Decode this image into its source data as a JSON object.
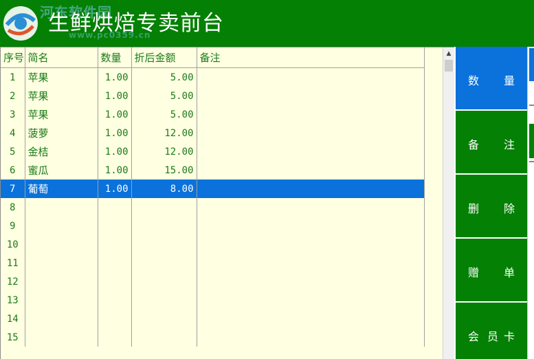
{
  "header": {
    "title": "生鲜烘焙专卖前台",
    "watermark": "河东软件园",
    "watermark_url": "www.pc0359.cn",
    "background": "#048004"
  },
  "grid": {
    "columns": [
      "序号",
      "简名",
      "数量",
      "折后金额",
      "备注"
    ],
    "rows": [
      {
        "no": "1",
        "name": "苹果",
        "qty": "1.00",
        "amount": "5.00",
        "note": ""
      },
      {
        "no": "2",
        "name": "苹果",
        "qty": "1.00",
        "amount": "5.00",
        "note": ""
      },
      {
        "no": "3",
        "name": "苹果",
        "qty": "1.00",
        "amount": "5.00",
        "note": ""
      },
      {
        "no": "4",
        "name": "菠萝",
        "qty": "1.00",
        "amount": "12.00",
        "note": ""
      },
      {
        "no": "5",
        "name": "金桔",
        "qty": "1.00",
        "amount": "12.00",
        "note": ""
      },
      {
        "no": "6",
        "name": "蜜瓜",
        "qty": "1.00",
        "amount": "15.00",
        "note": ""
      },
      {
        "no": "7",
        "name": "葡萄",
        "qty": "1.00",
        "amount": "8.00",
        "note": ""
      },
      {
        "no": "8",
        "name": "",
        "qty": "",
        "amount": "",
        "note": ""
      },
      {
        "no": "9",
        "name": "",
        "qty": "",
        "amount": "",
        "note": ""
      },
      {
        "no": "10",
        "name": "",
        "qty": "",
        "amount": "",
        "note": ""
      },
      {
        "no": "11",
        "name": "",
        "qty": "",
        "amount": "",
        "note": ""
      },
      {
        "no": "12",
        "name": "",
        "qty": "",
        "amount": "",
        "note": ""
      },
      {
        "no": "13",
        "name": "",
        "qty": "",
        "amount": "",
        "note": ""
      },
      {
        "no": "14",
        "name": "",
        "qty": "",
        "amount": "",
        "note": ""
      },
      {
        "no": "15",
        "name": "",
        "qty": "",
        "amount": "",
        "note": ""
      }
    ],
    "selected_row": "7",
    "background": "#ffffe1",
    "text_color": "#1a7a1a",
    "selection_color": "#0a72da"
  },
  "side_buttons": [
    {
      "id": "quantity",
      "chars": [
        "数",
        "量"
      ],
      "active": true
    },
    {
      "id": "note",
      "chars": [
        "备",
        "注"
      ],
      "active": false
    },
    {
      "id": "delete",
      "chars": [
        "删",
        "除"
      ],
      "active": false
    },
    {
      "id": "gift",
      "chars": [
        "赠",
        "单"
      ],
      "active": false
    },
    {
      "id": "member-card",
      "chars": [
        "会",
        "员",
        "卡"
      ],
      "active": false
    }
  ],
  "icons": {
    "logo": "hedong-logo-icon",
    "scroll_up": "arrow-up-icon"
  }
}
